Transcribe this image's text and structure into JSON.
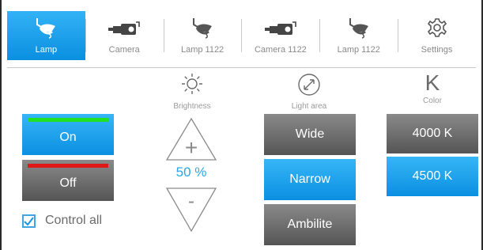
{
  "tabs": [
    {
      "label": "Lamp",
      "icon": "lamp-icon",
      "active": true
    },
    {
      "label": "Camera",
      "icon": "camera-icon",
      "active": false
    },
    {
      "label": "Lamp 1122",
      "icon": "lamp-icon",
      "active": false
    },
    {
      "label": "Camera 1122",
      "icon": "camera-icon",
      "active": false
    },
    {
      "label": "Lamp 1122",
      "icon": "lamp-icon",
      "active": false
    },
    {
      "label": "Settings",
      "icon": "gear-icon",
      "active": false
    }
  ],
  "power": {
    "on_label": "On",
    "off_label": "Off",
    "on_indicator_color": "#22e022",
    "off_indicator_color": "#e01818"
  },
  "brightness": {
    "caption": "Brightness",
    "value": "50 %",
    "plus": "+",
    "minus": "-"
  },
  "light_area": {
    "caption": "Light area",
    "options": [
      "Wide",
      "Narrow",
      "Ambilite"
    ],
    "selected": "Narrow"
  },
  "color": {
    "caption": "Color",
    "symbol": "K",
    "options": [
      "4000 K",
      "4500 K"
    ],
    "selected": "4500 K"
  },
  "control_all": {
    "label": "Control all",
    "checked": true
  },
  "colors": {
    "accent": "#0a96e6",
    "button_gray": "#6e6e6e"
  }
}
